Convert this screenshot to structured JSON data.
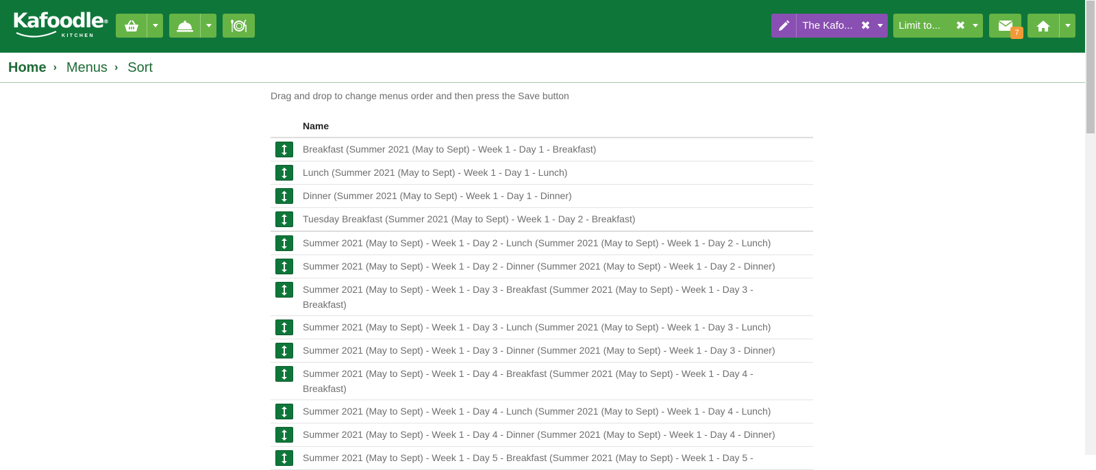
{
  "app": {
    "logo_text": "Kafoodle",
    "logo_sub": "KITCHEN",
    "logo_mark": "®"
  },
  "header": {
    "buttons": [
      {
        "name": "basket",
        "icon": "basket-icon"
      },
      {
        "name": "cloche",
        "icon": "cloche-icon"
      },
      {
        "name": "plate",
        "icon": "plate-cutlery-icon"
      }
    ],
    "site_selector": {
      "label": "The Kafo...",
      "clear": "✖",
      "icon": "pencil-icon"
    },
    "limit_selector": {
      "label": "Limit to...",
      "clear": "✖"
    },
    "messages": {
      "icon": "envelope-icon",
      "count": "7"
    },
    "home": {
      "icon": "home-icon"
    }
  },
  "breadcrumb": {
    "items": [
      "Home",
      "Menus",
      "Sort"
    ],
    "separator": "›"
  },
  "main": {
    "instructions": "Drag and drop to change menus order and then press the Save button",
    "table": {
      "column": "Name",
      "rows": [
        "Breakfast (Summer 2021 (May to Sept) - Week 1 - Day 1 - Breakfast)",
        "Lunch (Summer 2021 (May to Sept) - Week 1 - Day 1 - Lunch)",
        "Dinner (Summer 2021 (May to Sept) - Week 1 - Day 1 - Dinner)",
        "Tuesday Breakfast (Summer 2021 (May to Sept) - Week 1 - Day 2 - Breakfast)",
        "Summer 2021 (May to Sept) - Week 1 - Day 2 - Lunch (Summer 2021 (May to Sept) - Week 1 - Day 2 - Lunch)",
        "Summer 2021 (May to Sept) - Week 1 - Day 2 - Dinner (Summer 2021 (May to Sept) - Week 1 - Day 2 - Dinner)",
        "Summer 2021 (May to Sept) - Week 1 - Day 3 - Breakfast (Summer 2021 (May to Sept) - Week 1 - Day 3 - Breakfast)",
        "Summer 2021 (May to Sept) - Week 1 - Day 3 - Lunch (Summer 2021 (May to Sept) - Week 1 - Day 3 - Lunch)",
        "Summer 2021 (May to Sept) - Week 1 - Day 3 - Dinner (Summer 2021 (May to Sept) - Week 1 - Day 3 - Dinner)",
        "Summer 2021 (May to Sept) - Week 1 - Day 4 - Breakfast (Summer 2021 (May to Sept) - Week 1 - Day 4 - Breakfast)",
        "Summer 2021 (May to Sept) - Week 1 - Day 4 - Lunch (Summer 2021 (May to Sept) - Week 1 - Day 4 - Lunch)",
        "Summer 2021 (May to Sept) - Week 1 - Day 4 - Dinner (Summer 2021 (May to Sept) - Week 1 - Day 4 - Dinner)",
        "Summer 2021 (May to Sept) - Week 1 - Day 5 - Breakfast (Summer 2021 (May to Sept) - Week 1 - Day 5 -"
      ],
      "handle_icon": "drag-handle-icon"
    }
  },
  "colors": {
    "header": "#0f763a",
    "button": "#66b445",
    "selector": "#8a4fb2",
    "badge": "#f29a37"
  }
}
